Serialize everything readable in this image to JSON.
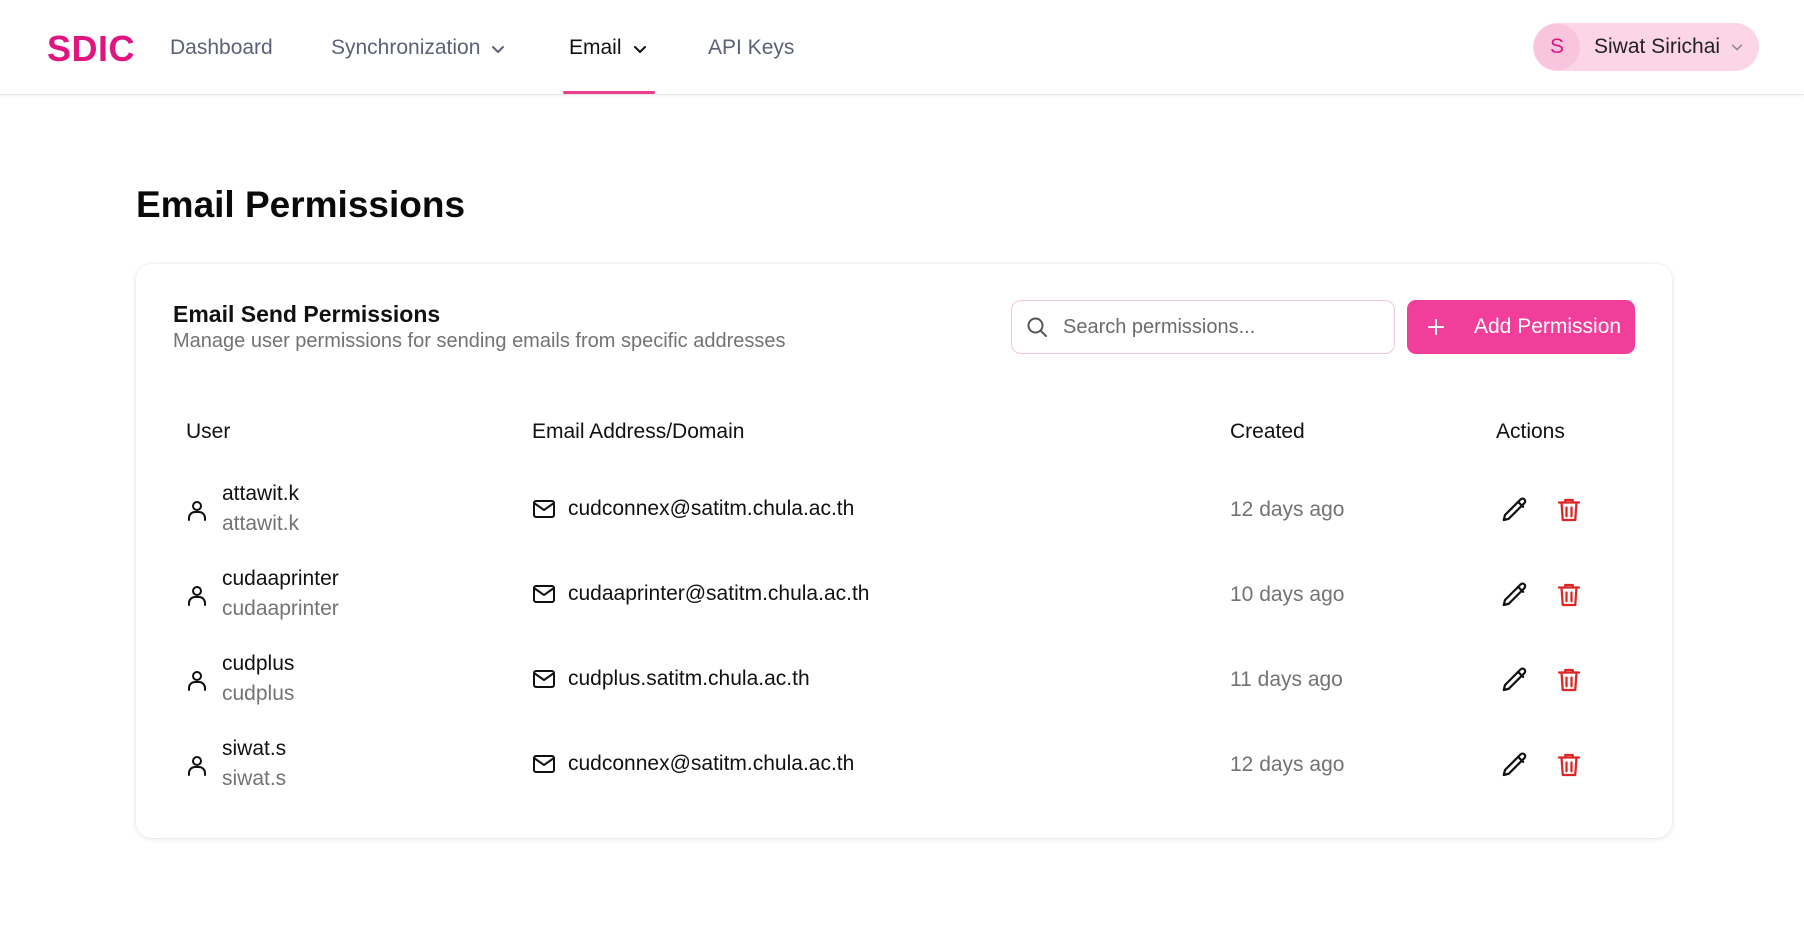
{
  "nav": {
    "brand": "SDIC",
    "items": [
      {
        "label": "Dashboard"
      },
      {
        "label": "Synchronization"
      },
      {
        "label": "Email"
      },
      {
        "label": "API Keys"
      }
    ],
    "active": "Email"
  },
  "user": {
    "initial": "S",
    "name": "Siwat Sirichai"
  },
  "page": {
    "title": "Email Permissions"
  },
  "card": {
    "title": "Email Send Permissions",
    "subtitle": "Manage user permissions for sending emails from specific addresses",
    "search_placeholder": "Search permissions...",
    "add_button": "Add Permission"
  },
  "table": {
    "columns": [
      "User",
      "Email Address/Domain",
      "Created",
      "Actions"
    ],
    "rows": [
      {
        "user": "attawit.k",
        "user_sub": "attawit.k",
        "email": "cudconnex@satitm.chula.ac.th",
        "created": "12 days ago"
      },
      {
        "user": "cudaaprinter",
        "user_sub": "cudaaprinter",
        "email": "cudaaprinter@satitm.chula.ac.th",
        "created": "10 days ago"
      },
      {
        "user": "cudplus",
        "user_sub": "cudplus",
        "email": "cudplus.satitm.chula.ac.th",
        "created": "11 days ago"
      },
      {
        "user": "siwat.s",
        "user_sub": "siwat.s",
        "email": "cudconnex@satitm.chula.ac.th",
        "created": "12 days ago"
      }
    ]
  },
  "colors": {
    "brand": "#e0157f",
    "accent": "#f23e9b",
    "delete": "#dc2626",
    "muted_text": "#737373"
  },
  "icons": {
    "nav_dropdown": "chevron-down-icon",
    "search": "search-icon",
    "add": "plus-icon",
    "user": "user-icon",
    "email": "mail-icon",
    "edit": "pencil-icon",
    "delete": "trash-icon"
  }
}
